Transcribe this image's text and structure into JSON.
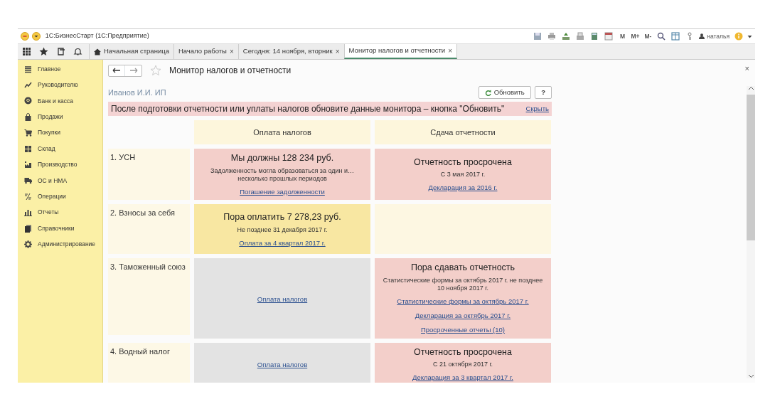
{
  "window": {
    "title": "1С:БизнесСтарт (1С:Предприятие)"
  },
  "toolbar": [
    {
      "kind": "save"
    },
    {
      "kind": "print"
    },
    {
      "kind": "upload"
    },
    {
      "kind": "scan"
    },
    {
      "kind": "calc"
    },
    {
      "kind": "calendar"
    },
    {
      "kind": "text",
      "label": "M"
    },
    {
      "kind": "text",
      "label": "M+"
    },
    {
      "kind": "text",
      "label": "M-"
    },
    {
      "kind": "search"
    },
    {
      "kind": "panel"
    },
    {
      "kind": "tree"
    },
    {
      "kind": "user",
      "label": "наталья"
    },
    {
      "kind": "info"
    }
  ],
  "quick_icons": [
    {
      "kind": "apps"
    },
    {
      "kind": "star"
    },
    {
      "kind": "history"
    },
    {
      "kind": "bell"
    }
  ],
  "tabs": [
    {
      "label": "Начальная страница",
      "kind": "home",
      "selected": false
    },
    {
      "label": "Начало работы",
      "kind": "closable",
      "selected": false
    },
    {
      "label": "Сегодня: 14 ноября, вторник",
      "kind": "closable",
      "selected": false
    },
    {
      "label": "Монитор налогов и отчетности",
      "kind": "closable",
      "selected": true
    }
  ],
  "tab_close": "×",
  "sidebar": {
    "items": [
      {
        "label": "Главное",
        "kind": "menu"
      },
      {
        "label": "Руководителю",
        "kind": "trend"
      },
      {
        "label": "Банк и касса",
        "kind": "coin"
      },
      {
        "label": "Продажи",
        "kind": "bag"
      },
      {
        "label": "Покупки",
        "kind": "cart"
      },
      {
        "label": "Склад",
        "kind": "grid"
      },
      {
        "label": "Производство",
        "kind": "factory"
      },
      {
        "label": "ОС и НМА",
        "kind": "truck"
      },
      {
        "label": "Операции",
        "kind": "ops"
      },
      {
        "label": "Отчеты",
        "kind": "chart"
      },
      {
        "label": "Справочники",
        "kind": "books"
      },
      {
        "label": "Администрирование",
        "kind": "gear"
      }
    ]
  },
  "form": {
    "title": "Монитор налогов и отчетности",
    "close": "×",
    "organization": "Иванов И.И. ИП",
    "refresh_button": "Обновить",
    "help_button": "?",
    "notice": {
      "text": "После подготовки отчетности или уплаты налогов обновите данные монитора – кнопка \"Обновить\"",
      "hide_link": "Скрыть"
    },
    "columns": [
      "Оплата налогов",
      "Сдача отчетности"
    ],
    "rows": [
      {
        "label": "1. УСН",
        "cells": [
          {
            "kind": "overdue",
            "heading": "Мы должны 128 234 руб.",
            "text": "Задолженность могла образоваться за один и… несколько прошлых периодов",
            "links": [
              "Погашение задолженности"
            ]
          },
          {
            "kind": "overdue",
            "heading": "Отчетность просрочена",
            "text": "С 3 мая 2017 г.",
            "links": [
              "Декларация за 2016 г."
            ]
          }
        ]
      },
      {
        "label": "2. Взносы за себя",
        "cells": [
          {
            "kind": "due",
            "heading": "Пора оплатить 7 278,23 руб.",
            "text": "Не позднее 31 декабря 2017 г.",
            "links": [
              "Оплата за 4 квартал 2017 г."
            ]
          },
          {
            "kind": "empty"
          }
        ]
      },
      {
        "label": "3. Таможенный союз",
        "cells": [
          {
            "kind": "none",
            "links": [
              "Оплата налогов"
            ]
          },
          {
            "kind": "overdue",
            "heading": "Пора сдавать отчетность",
            "text": "Статистические формы за октябрь 2017 г. не позднее 10 ноября 2017 г.",
            "links": [
              "Статистические формы за октябрь 2017 г.",
              "Декларация за октябрь 2017 г.",
              "Просроченные отчеты (10)"
            ]
          }
        ]
      },
      {
        "label": "4. Водный налог",
        "cells": [
          {
            "kind": "none",
            "links": [
              "Оплата налогов"
            ]
          },
          {
            "kind": "overdue",
            "heading": "Отчетность просрочена",
            "text": "С 21 октября 2017 г.",
            "links": [
              "Декларация за 3 квартал 2017 г."
            ]
          }
        ]
      }
    ]
  }
}
